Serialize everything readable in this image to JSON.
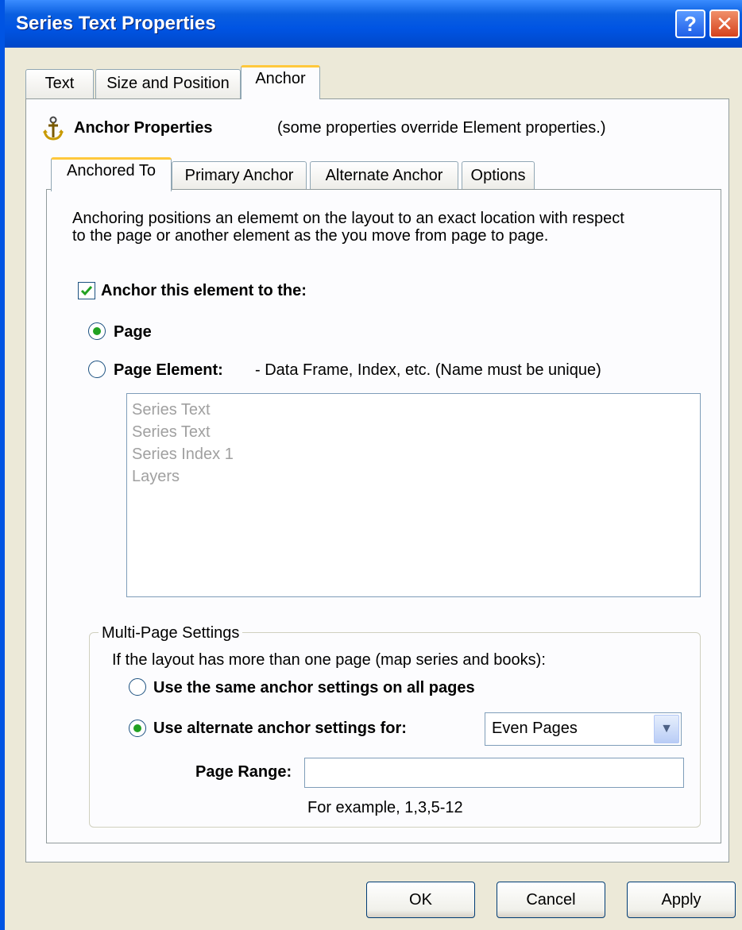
{
  "window": {
    "title": "Series Text Properties",
    "help_glyph": "?",
    "close_glyph": "✕"
  },
  "tabs": [
    {
      "label": "Text"
    },
    {
      "label": "Size and Position"
    },
    {
      "label": "Anchor",
      "active": true
    }
  ],
  "anchor_header": {
    "icon": "anchor-icon",
    "title": "Anchor Properties",
    "note": "(some properties override Element properties.)"
  },
  "sub_tabs": [
    {
      "label": "Anchored To",
      "active": true
    },
    {
      "label": "Primary Anchor"
    },
    {
      "label": "Alternate Anchor"
    },
    {
      "label": "Options"
    }
  ],
  "description": {
    "line1": "Anchoring positions an elememt on the layout to an exact location with respect",
    "line2": "to the page or another element as the you move from page to page."
  },
  "anchor_checkbox": {
    "label": "Anchor this element to the:",
    "checked": true
  },
  "anchor_to": {
    "page_label": "Page",
    "page_element_label": "Page Element:",
    "page_element_hint": "- Data Frame, Index, etc. (Name must be unique)",
    "selected": "page"
  },
  "elements_list": [
    "Series Text",
    "Series Text",
    "Series Index 1",
    "Layers"
  ],
  "multi_page": {
    "legend": "Multi-Page Settings",
    "intro": "If the layout has more than one page (map series and books):",
    "same_label": "Use the same anchor settings on all pages",
    "alternate_label": "Use alternate anchor settings for:",
    "selected": "alternate",
    "pages_select": "Even Pages",
    "page_range_label": "Page Range:",
    "page_range_value": "",
    "example": "For example, 1,3,5-12"
  },
  "buttons": {
    "ok": "OK",
    "cancel": "Cancel",
    "apply": "Apply"
  },
  "colors": {
    "title_blue": "#0054E3",
    "dialog_bg": "#ECE9D8",
    "tab_highlight": "#FFC83C",
    "radio_dot": "#21A121"
  }
}
